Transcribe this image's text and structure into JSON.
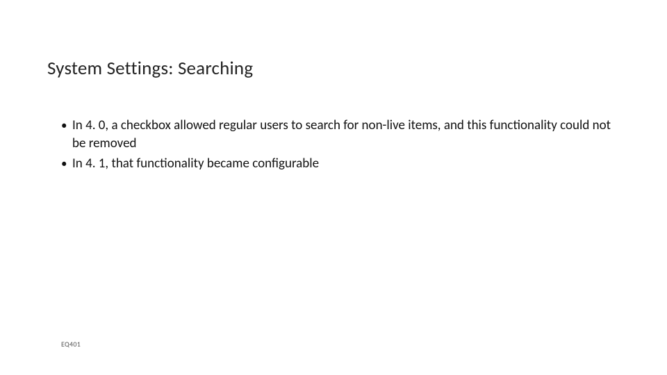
{
  "title": "System Settings: Searching",
  "bullets": [
    "In 4. 0, a checkbox allowed regular users to search for non-live items, and this functionality could not be removed",
    "In 4. 1, that functionality became configurable"
  ],
  "footer": "EQ401"
}
